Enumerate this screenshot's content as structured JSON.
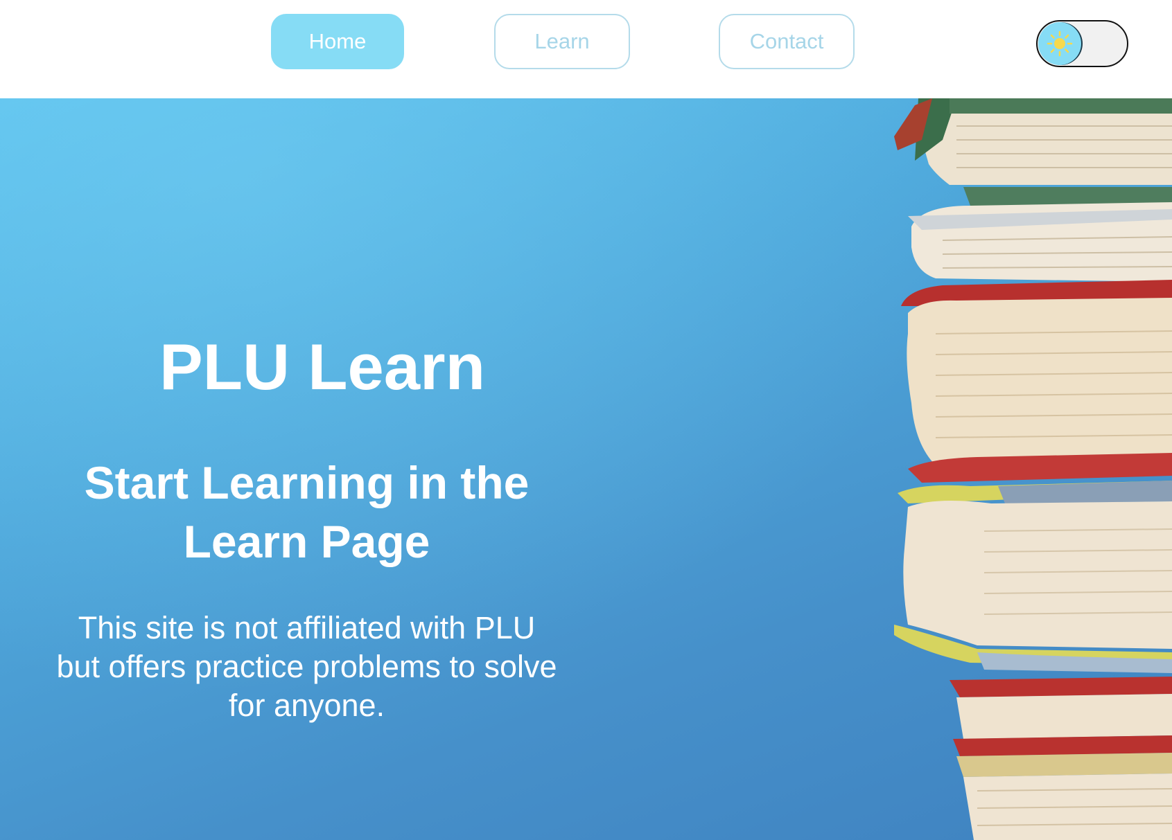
{
  "nav": {
    "items": [
      {
        "label": "Home",
        "active": true
      },
      {
        "label": "Learn",
        "active": false
      },
      {
        "label": "Contact",
        "active": false
      }
    ]
  },
  "theme_toggle": {
    "icon": "sun-icon",
    "state": "light"
  },
  "hero": {
    "title": "PLU Learn",
    "subtitle": "Start Learning in the Learn Page",
    "description": "This site is not affiliated with PLU but offers practice problems to solve for anyone."
  },
  "colors": {
    "accent": "#86dcf5",
    "nav_outline": "#b4dbea",
    "nav_text_inactive": "#a6d5e8",
    "hero_background": "#4fa9dc"
  }
}
